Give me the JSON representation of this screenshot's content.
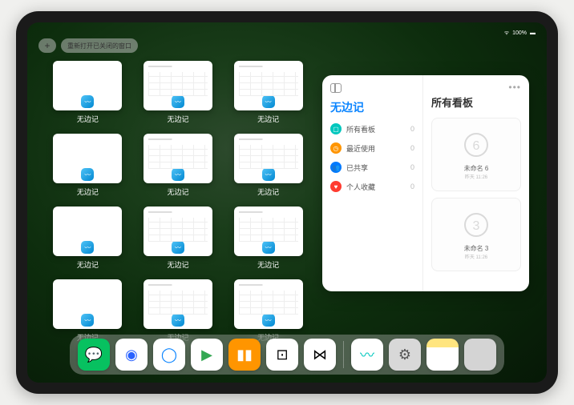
{
  "status": {
    "battery": "100%",
    "wifi": "wifi-icon"
  },
  "topbar": {
    "plus": "+",
    "reopen_label": "重新打开已关闭的窗口"
  },
  "app_name": "无边记",
  "thumbnails": [
    {
      "label": "无边记",
      "variant": "blank"
    },
    {
      "label": "无边记",
      "variant": "detailed"
    },
    {
      "label": "无边记",
      "variant": "detailed"
    },
    {
      "label": "无边记",
      "variant": "blank"
    },
    {
      "label": "无边记",
      "variant": "detailed"
    },
    {
      "label": "无边记",
      "variant": "detailed"
    },
    {
      "label": "无边记",
      "variant": "blank"
    },
    {
      "label": "无边记",
      "variant": "detailed"
    },
    {
      "label": "无边记",
      "variant": "detailed"
    },
    {
      "label": "无边记",
      "variant": "blank"
    },
    {
      "label": "无边记",
      "variant": "detailed"
    },
    {
      "label": "无边记",
      "variant": "detailed"
    }
  ],
  "panel": {
    "title": "无边记",
    "right_title": "所有看板",
    "sidebar": [
      {
        "name": "all",
        "label": "所有看板",
        "count": 0,
        "color": "c-teal",
        "glyph": "▢"
      },
      {
        "name": "recent",
        "label": "最近使用",
        "count": 0,
        "color": "c-orange",
        "glyph": "◷"
      },
      {
        "name": "shared",
        "label": "已共享",
        "count": 0,
        "color": "c-blue",
        "glyph": "👥"
      },
      {
        "name": "favorites",
        "label": "个人收藏",
        "count": 0,
        "color": "c-red",
        "glyph": "♥"
      }
    ],
    "boards": [
      {
        "name": "未命名 6",
        "date": "昨天 11:26",
        "sketch": "6"
      },
      {
        "name": "未命名 3",
        "date": "昨天 11:26",
        "sketch": "3"
      }
    ]
  },
  "dock": {
    "main": [
      {
        "name": "wechat",
        "bg": "#07c160",
        "glyph": "💬",
        "glyphColor": "#fff"
      },
      {
        "name": "app-blue-eye",
        "bg": "#fff",
        "glyph": "◉",
        "glyphColor": "#2962ff"
      },
      {
        "name": "qq-browser",
        "bg": "#fff",
        "glyph": "◯",
        "glyphColor": "#0a84ff"
      },
      {
        "name": "play-media",
        "bg": "#fff",
        "glyph": "▶",
        "glyphColor": "#34a853"
      },
      {
        "name": "books",
        "bg": "#ff9500",
        "glyph": "▮▮",
        "glyphColor": "#fff"
      },
      {
        "name": "dice-app",
        "bg": "#fff",
        "glyph": "⊡",
        "glyphColor": "#000"
      },
      {
        "name": "connect-app",
        "bg": "#fff",
        "glyph": "⋈",
        "glyphColor": "#000"
      }
    ],
    "recent": [
      {
        "name": "freeform",
        "bg": "#fff",
        "glyph": "〰",
        "glyphColor": "#00c7be"
      },
      {
        "name": "settings",
        "bg": "#d8d8d8",
        "glyph": "⚙",
        "glyphColor": "#555"
      },
      {
        "name": "notes",
        "bg": "linear-gradient(#ffe57f 28%, #fff 28%)",
        "glyph": "",
        "glyphColor": ""
      },
      {
        "name": "app-library",
        "bg": "#d4d4d4",
        "glyph": "",
        "glyphColor": "",
        "grid": true
      }
    ]
  }
}
